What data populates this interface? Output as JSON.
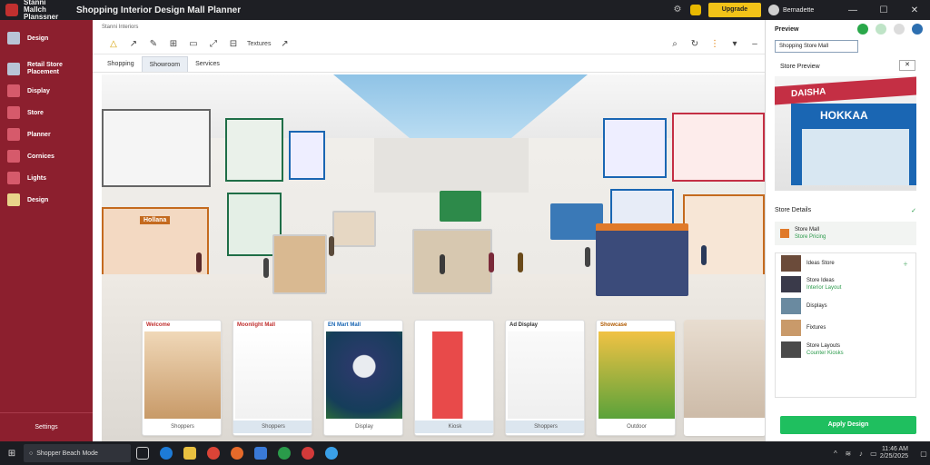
{
  "titlebar": {
    "app_name": "Stanni Mallch Planssner",
    "doc_title": "Shopping Interior Design Mall Planner",
    "upgrade_label": "Upgrade",
    "user_name": "Bernadette",
    "win_controls": [
      "—",
      "☐",
      "✕"
    ]
  },
  "sidebar": {
    "items": [
      {
        "label": "Design",
        "icon": "cube-icon"
      },
      {
        "label": "Retail Store Placement",
        "icon": "layout-icon"
      },
      {
        "label": "Display",
        "icon": "box-icon"
      },
      {
        "label": "Store",
        "icon": "grid-icon"
      },
      {
        "label": "Planner",
        "icon": "table-icon"
      },
      {
        "label": "Cornices",
        "icon": "list-icon"
      },
      {
        "label": "Lights",
        "icon": "door-icon"
      },
      {
        "label": "Design",
        "icon": "folder-icon"
      }
    ],
    "bottom_label": "Settings"
  },
  "main": {
    "brand": "Stanni Interiors",
    "toolbar": [
      "△",
      "↗",
      "✎",
      "⊞",
      "▭",
      "⤢",
      "⊟",
      "Textures",
      "↗"
    ],
    "toolbar_right": [
      "⌕",
      "↻",
      "⋮",
      "▾",
      "–"
    ],
    "tabs": [
      "Shopping",
      "Showroom",
      "Services"
    ],
    "active_tab": 1,
    "storefront_sign": "Hollana",
    "cards": [
      {
        "caption": "Welcome",
        "label": "Shoppers"
      },
      {
        "caption": "Moonlight Mall",
        "label": "Shoppers"
      },
      {
        "caption": "EN Mart Mall",
        "label": "Display"
      },
      {
        "caption": "",
        "label": "Kiosk"
      },
      {
        "caption": "Ad Display",
        "label": "Shoppers"
      },
      {
        "caption": "Showcase",
        "label": "Outdoor"
      },
      {
        "caption": "",
        "label": ""
      }
    ]
  },
  "right_panel": {
    "title": "Preview",
    "dropdown": "Shopping Store Mall",
    "subtitle": "Store Preview",
    "close": "✕",
    "preview_band": "DAISHA",
    "preview_sign": "HOKKAA",
    "section_header": "Store Details",
    "detail": {
      "title": "Store Mall",
      "sub": "Store Pricing"
    },
    "list_header": "Ideas Store",
    "list_items": [
      {
        "title": "Store Ideas",
        "sub": "Interior Layout"
      },
      {
        "title": "Displays",
        "sub": ""
      },
      {
        "title": "Fixtures",
        "sub": ""
      },
      {
        "title": "Store Layouts",
        "sub": "Counter Kiosks"
      }
    ],
    "apply_label": "Apply Design"
  },
  "taskbar": {
    "search_placeholder": "Shopper Beach Mode",
    "tray_line1": "11:46 AM",
    "tray_line2": "2/25/2025"
  },
  "colors": {
    "sidebar": "#8c1f2e",
    "upgrade": "#f2c318",
    "apply": "#1fbf5f",
    "accent_blue": "#1a66b3"
  }
}
